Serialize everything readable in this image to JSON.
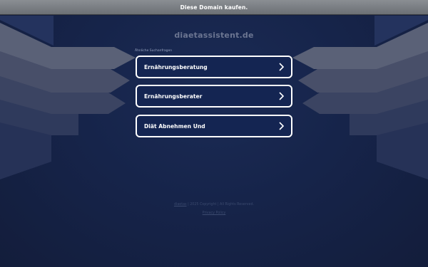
{
  "banner": {
    "text": "Diese Domain kaufen."
  },
  "domain": {
    "title": "diaetassistent.de"
  },
  "related": {
    "label": "Ähnliche Suchanfragen",
    "links": [
      {
        "label": "Ernährungsberatung"
      },
      {
        "label": "Ernährungsberater"
      },
      {
        "label": "Diät Abnehmen Und"
      }
    ]
  },
  "footer": {
    "site_link": "diaetas",
    "copyright_text": "| 2025 Copyright | All Rights Reserved.",
    "privacy": "Privacy Policy"
  },
  "colors": {
    "background": "#152040",
    "link_box_fill": "#142552",
    "link_box_border": "#ffffff",
    "banner": "#7c8085"
  },
  "icons": {
    "link_arrow": "chevron-right-icon"
  }
}
